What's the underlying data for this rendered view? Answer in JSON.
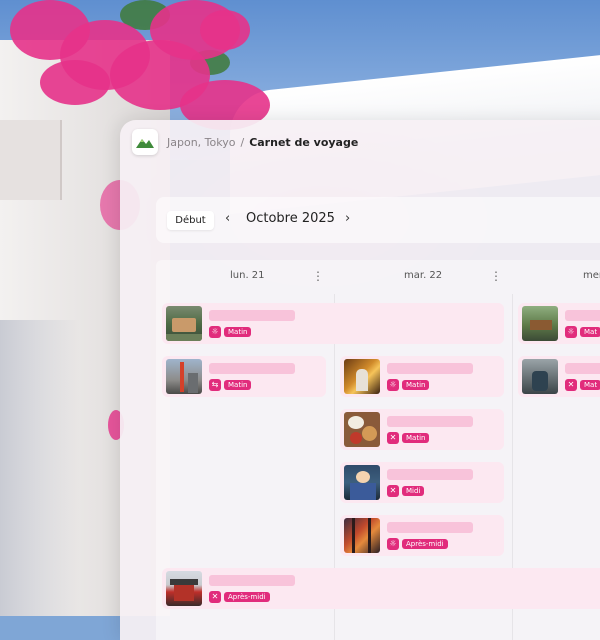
{
  "header": {
    "breadcrumb_location": "Japon, Tokyo",
    "breadcrumb_separator": "/",
    "breadcrumb_current": "Carnet de voyage"
  },
  "toolbar": {
    "start_label": "Début",
    "prev_icon": "‹",
    "next_icon": "›",
    "month_label": "Octobre 2025"
  },
  "calendar": {
    "columns": [
      {
        "label": "lun. 21",
        "menu": "⋮"
      },
      {
        "label": "mar. 22",
        "menu": "⋮"
      },
      {
        "label": "mer"
      }
    ],
    "events": [
      {
        "tag": "Matin",
        "icon": "sun-icon"
      },
      {
        "tag": "Matin",
        "icon": "train-icon"
      },
      {
        "tag": "Matin",
        "icon": "sun-icon"
      },
      {
        "tag": "Matin",
        "icon": "utensils-icon"
      },
      {
        "tag": "Midi",
        "icon": "utensils-icon"
      },
      {
        "tag": "Après-midi",
        "icon": "sun-icon"
      },
      {
        "tag": "Après-midi",
        "icon": "utensils-icon"
      },
      {
        "tag": "Mat",
        "icon": "sun-icon"
      },
      {
        "tag": "Mat",
        "icon": "utensils-icon"
      }
    ]
  },
  "colors": {
    "accent": "#e12c7c",
    "event_bg": "#fce8f1",
    "placeholder_bar": "#f8c3da"
  }
}
